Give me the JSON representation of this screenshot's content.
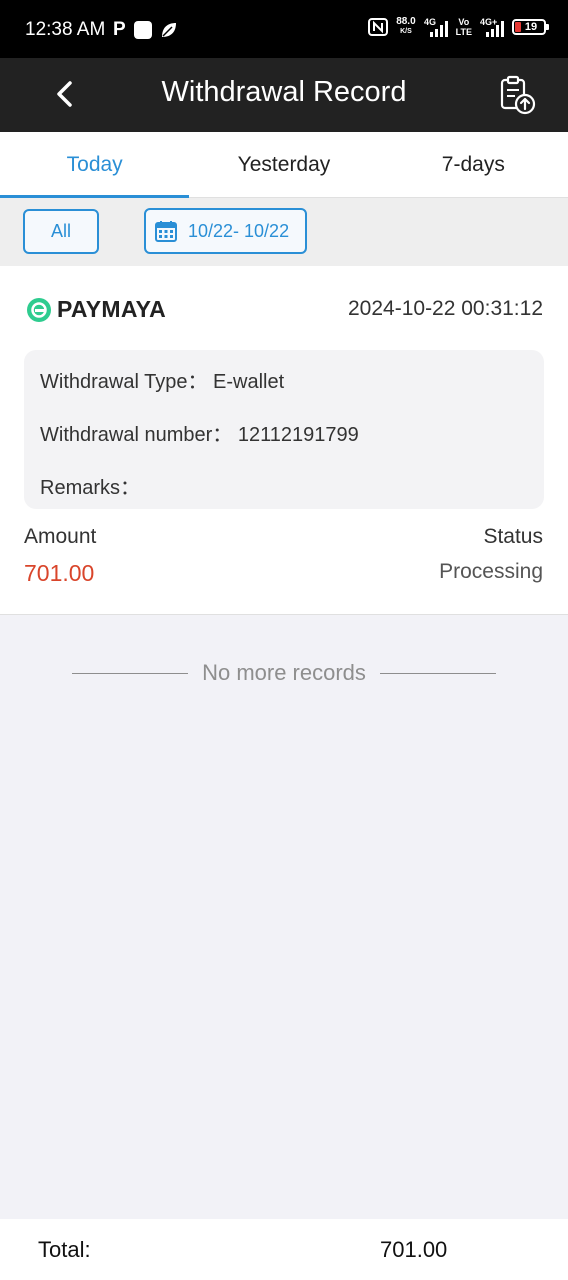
{
  "status_bar": {
    "time": "12:38 AM",
    "net_speed": "88.0",
    "net_speed_unit": "K/S",
    "sim1": "4G",
    "volte_top": "Vo",
    "volte_bottom": "LTE",
    "sim2": "4G+",
    "battery": "19"
  },
  "header": {
    "title": "Withdrawal Record"
  },
  "tabs": [
    {
      "label": "Today",
      "active": true
    },
    {
      "label": "Yesterday",
      "active": false
    },
    {
      "label": "7-days",
      "active": false
    }
  ],
  "filters": {
    "all_label": "All",
    "date_range": "10/22- 10/22"
  },
  "record": {
    "brand": "PAYMAYA",
    "datetime": "2024-10-22 00:31:12",
    "type_label": "Withdrawal Type：",
    "type_value": "E-wallet",
    "number_label": "Withdrawal number：",
    "number_value": "12112191799",
    "remarks_label": "Remarks：",
    "remarks_value": "",
    "amount_label": "Amount",
    "amount_value": "701.00",
    "status_label": "Status",
    "status_value": "Processing"
  },
  "no_more": "No more records",
  "footer": {
    "total_label": "Total:",
    "total_value": "701.00"
  },
  "colors": {
    "accent": "#2a8fd6",
    "amount": "#d9452b",
    "header_bg": "#222222",
    "brand_green": "#2ecc8f"
  }
}
